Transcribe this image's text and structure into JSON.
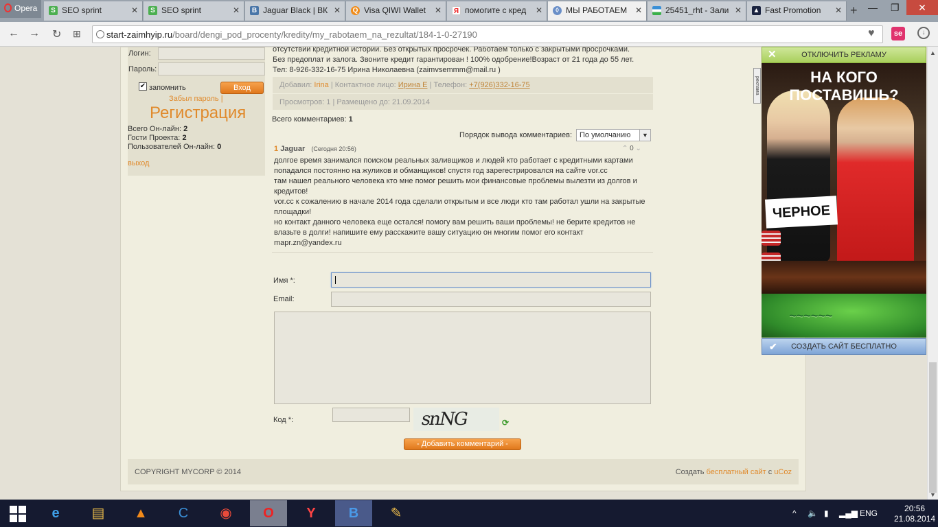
{
  "browser": {
    "menu_label": "Opera",
    "tabs": [
      {
        "label": "SEO sprint",
        "icon": "seosprint-icon"
      },
      {
        "label": "SEO sprint",
        "icon": "seosprint-icon"
      },
      {
        "label": "Jaguar Black | ВК",
        "icon": "vk-icon"
      },
      {
        "label": "Visa QIWI Wallet",
        "icon": "qiwi-icon"
      },
      {
        "label": "помогите с кред",
        "icon": "yandex-icon"
      },
      {
        "label": "МЫ РАБОТАЕМ",
        "icon": "site-icon"
      },
      {
        "label": "25451_rht - Зали",
        "icon": "uzbek-flag-icon"
      },
      {
        "label": "Fast Promotion",
        "icon": "fastpromo-icon"
      }
    ],
    "url_host": "start-zaimhyip.ru",
    "url_path": "/board/dengi_pod_procenty/kredity/my_rabotaem_na_rezultat/184-1-0-27190"
  },
  "sidebar": {
    "login_label": "Логин:",
    "password_label": "Пароль:",
    "remember_label": "запомнить",
    "login_button": "Вход",
    "forgot_link": "Забыл пароль",
    "forgot_sep": "|",
    "register_link": "Регистрация",
    "stats": {
      "online_label": "Всего Он-лайн:",
      "online_value": "2",
      "guests_label": "Гости Проекта:",
      "guests_value": "2",
      "users_label": "Пользователей Он-лайн:",
      "users_value": "0"
    },
    "logout_link": "выход"
  },
  "ad_text": {
    "line1": "отсутствии кредитной истории. Без открытых просрочек. Работаем только с закрытыми просрочками.",
    "line2": "Без предоплат и залога. Звоните кредит гарантирован ! 100% одобрение!Возраст от 21 года до 55 лет.",
    "line3": "Тел: 8-926-332-16-75 Ирина Николаевна (zaimvsemmm@mail.ru )"
  },
  "info": {
    "added_label": "Добавил:",
    "added_value": "Irina",
    "contact_label": "| Контактное лицо:",
    "contact_value": "Ирина Е",
    "phone_label": "| Телефон:",
    "phone_value": "+7(926)332-16-75",
    "views": "Просмотров: 1 | Размещено до: 21.09.2014"
  },
  "comments": {
    "total_label": "Всего комментариев:",
    "total_value": "1",
    "order_label": "Порядок вывода комментариев:",
    "order_value": "По умолчанию",
    "items": [
      {
        "num": "1",
        "author": "Jaguar",
        "date": "(Сегодня 20:56)",
        "rating": "0",
        "lines": [
          "долгое время занимался поиском реальных заливщиков и людей кто работает с кредитными картами",
          "попадался постоянно на жуликов и обманщиков! спустя год зарегестрировался на сайте vor.cc",
          "там нашел реального человека кто мне помог решить мои финансовые проблемы вылезти из долгов и",
          "кредитов!",
          "vor.cc к сожалению в начале 2014 года сделали открытым и все люди кто там работал ушли на закрытые",
          "площадки!",
          "но контакт данного человека еще остался! помогу вам решить ваши проблемы! не берите кредитов не",
          "влазьте в долги! напишите ему расскажите вашу ситуацию он многим помог его контакт",
          "mapr.zn@yandex.ru"
        ]
      }
    ]
  },
  "form": {
    "name_label": "Имя *:",
    "email_label": "Email:",
    "code_label": "Код *:",
    "captcha_text": "snNG",
    "submit_label": "- Добавить комментарий -"
  },
  "footer": {
    "copyright": "COPYRIGHT MYCORP © 2014",
    "credit_prefix": "Создать",
    "credit_link": "бесплатный сайт",
    "credit_mid": "с",
    "credit_ucoz": "uCoz"
  },
  "banner": {
    "disable_ads": "ОТКЛЮЧИТЬ РЕКЛАМУ",
    "headline": "НА КОГО ПОСТАВИШЬ?",
    "caption": "ЧЕРНОЕ",
    "create_site": "СОЗДАТЬ САЙТ БЕСПЛАТНО",
    "side_label": "реклама"
  },
  "taskbar": {
    "apps": [
      "ie-icon",
      "explorer-icon",
      "avast-icon",
      "ccleaner-icon",
      "chrome-icon",
      "opera-icon",
      "yandex-browser-icon",
      "vk-icon",
      "paint-icon"
    ],
    "lang": "ENG",
    "time": "20:56",
    "date": "21.08.2014"
  },
  "colors": {
    "accent_orange": "#e08a2c",
    "page_bg": "#f0eedf",
    "taskbar": "#151a30"
  }
}
